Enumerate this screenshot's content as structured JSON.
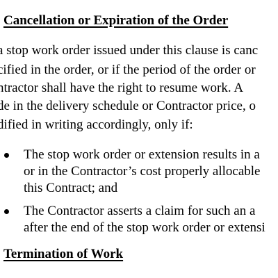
{
  "heading_cancellation": "Cancellation or Expiration of the Order",
  "paragraph_lines": [
    "a stop work order issued under this clause is canc",
    "cified in the order, or if the period of the order or",
    "ntractor shall have the right to resume work.  A",
    "de in the delivery schedule or Contractor price, o",
    "dified in writing accordingly, only if:"
  ],
  "bullets": [
    {
      "lines": [
        "The stop work order or extension results in a",
        "or in the Contractor’s cost properly allocable",
        "this Contract; and"
      ]
    },
    {
      "lines": [
        "The Contractor asserts a claim for such an a",
        "after the end of the stop work order or extensi"
      ]
    }
  ],
  "heading_termination": "Termination of Work"
}
